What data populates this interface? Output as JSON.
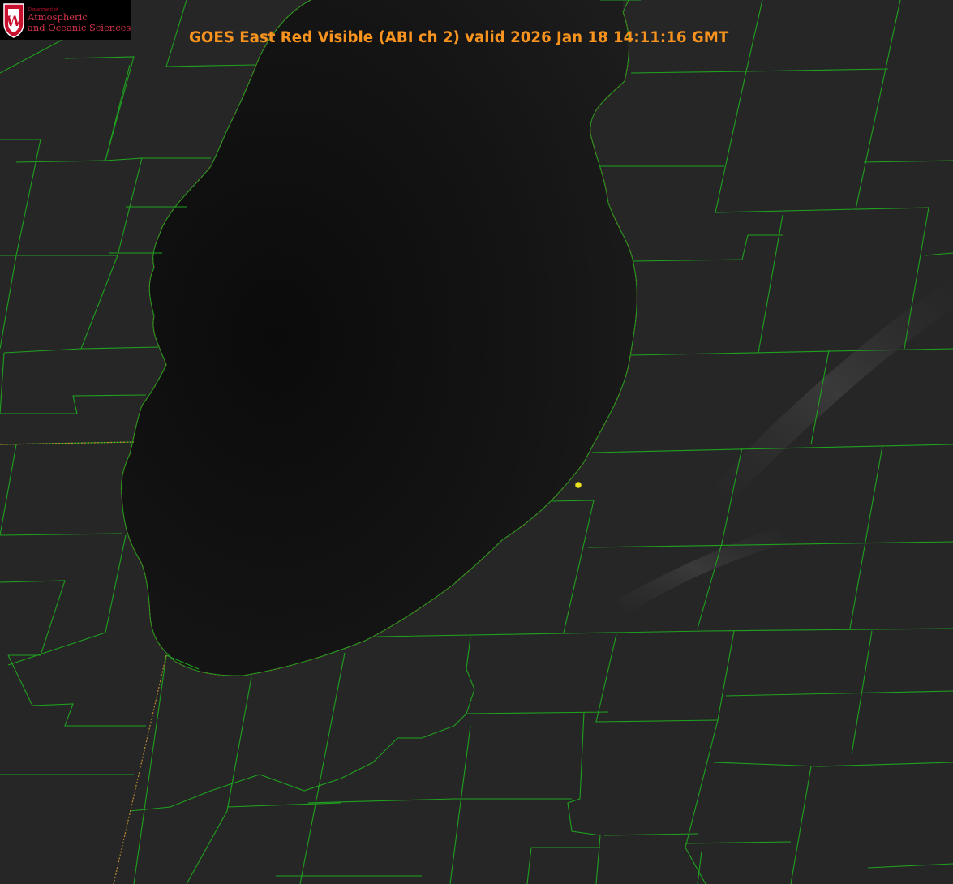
{
  "title": "GOES East Red Visible (ABI ch 2) valid 2026 Jan 18 14:11:16 GMT",
  "logo": {
    "emblem": "W",
    "department": "Department of",
    "line1": "Atmospheric",
    "line2": "and Oceanic Sciences"
  },
  "colors": {
    "land": "#272727",
    "lake": "#101010",
    "county_border": "#1fa11f",
    "state_border": "#c0a030",
    "coastline": "#e02020",
    "title": "#f7931e",
    "logo_text": "#d4334a",
    "marker": "#e8e020"
  },
  "icons": {
    "logo": "uw-crest-icon",
    "marker": "location-dot-icon"
  }
}
